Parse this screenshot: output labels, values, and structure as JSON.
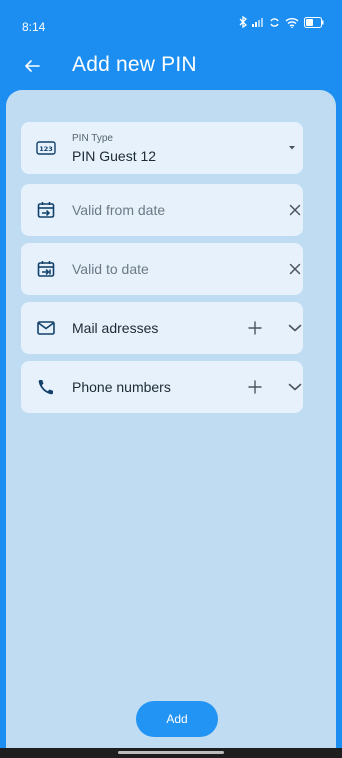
{
  "status_bar": {
    "time": "8:14",
    "battery": "40",
    "icons": [
      "bluetooth-icon",
      "signal-icon",
      "sync-icon",
      "wifi-icon",
      "battery-icon"
    ]
  },
  "app_bar": {
    "back_icon": "arrow-left-icon",
    "title": "Add new PIN"
  },
  "form": {
    "pin_type": {
      "label": "PIN Type",
      "value": "PIN Guest 12",
      "icon": "pin-123-icon",
      "trailing_icon": "dropdown-arrow-icon"
    },
    "valid_from": {
      "placeholder": "Valid from date",
      "icon": "calendar-arrow-icon",
      "trailing_icon": "clear-icon"
    },
    "valid_to": {
      "placeholder": "Valid to date",
      "icon": "calendar-arrow-icon",
      "trailing_icon": "clear-icon"
    },
    "mail": {
      "label": "Mail adresses",
      "icon": "mail-icon",
      "actions": [
        "plus-icon",
        "chevron-down-icon"
      ]
    },
    "phone": {
      "label": "Phone numbers",
      "icon": "phone-icon",
      "actions": [
        "plus-icon",
        "chevron-down-icon"
      ]
    }
  },
  "footer": {
    "add_label": "Add"
  },
  "colors": {
    "primary": "#1c8ef1",
    "surface": "#bfdcf3",
    "field": "#e6f1fb",
    "icon": "#12406b"
  }
}
